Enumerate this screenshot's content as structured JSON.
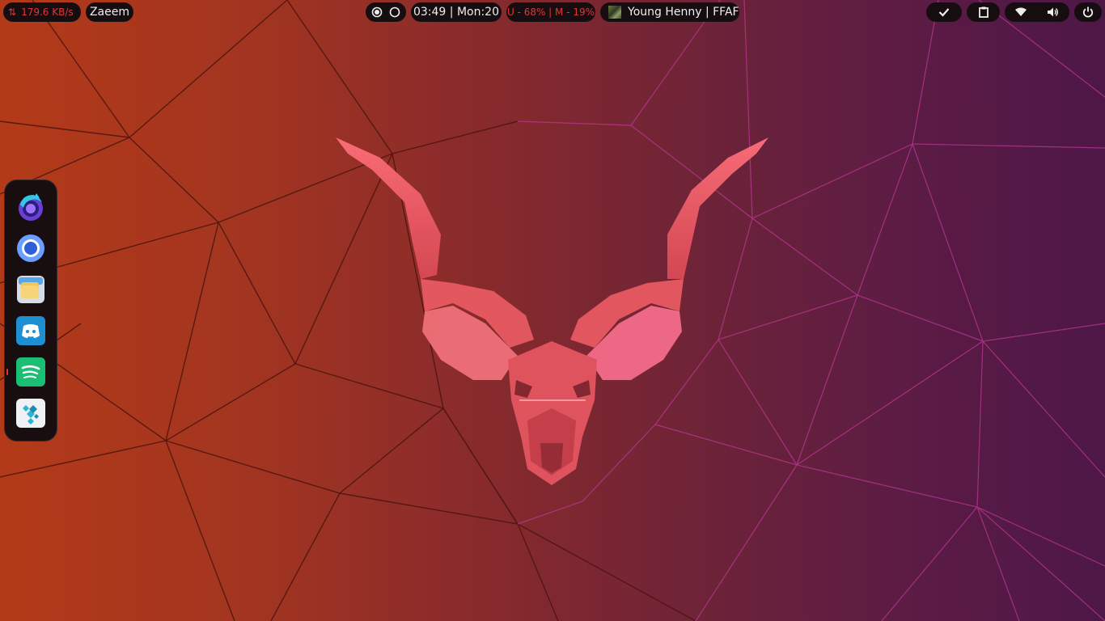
{
  "top_bar": {
    "network_speed": "179.6 KB/s",
    "username": "Zaeem",
    "clock": "03:49 | Mon:20",
    "usage": "U - 68% | M -  19%",
    "now_playing": "Young Henny | FFAF"
  },
  "dock": {
    "apps": [
      {
        "name": "Firefox",
        "icon": "firefox-icon"
      },
      {
        "name": "Chromium",
        "icon": "chromium-icon"
      },
      {
        "name": "Files",
        "icon": "files-icon"
      },
      {
        "name": "Discord",
        "icon": "discord-icon"
      },
      {
        "name": "Spotify",
        "icon": "spotify-icon"
      },
      {
        "name": "Kodi",
        "icon": "kodi-icon"
      }
    ]
  },
  "colors": {
    "bar_bg": "#160d10",
    "accent_red": "#e43535",
    "text": "#eeeeee"
  }
}
